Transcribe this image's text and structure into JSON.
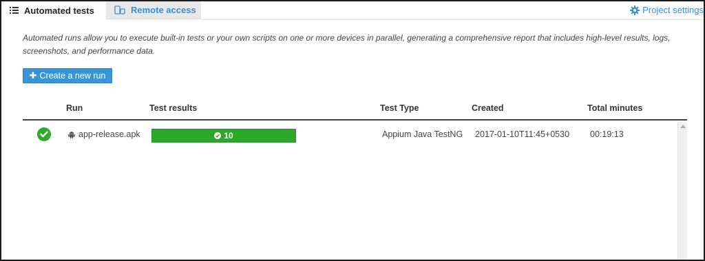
{
  "tabs": [
    {
      "label": "Automated tests",
      "icon": "list-icon",
      "active": true
    },
    {
      "label": "Remote access",
      "icon": "devices-icon",
      "active": false
    }
  ],
  "project_settings": {
    "label": "Project settings",
    "icon": "gear-icon"
  },
  "description": "Automated runs allow you to execute built-in tests or your own scripts on one or more devices in parallel, generating a comprehensive report that includes high-level results, logs, screenshots, and performance data.",
  "create_button": {
    "label": "Create a new run",
    "icon": "plus-icon"
  },
  "table": {
    "columns": [
      "Run",
      "Test results",
      "Test Type",
      "Created",
      "Total minutes"
    ],
    "rows": [
      {
        "status": "passed",
        "status_icon": "check-circle-icon",
        "run": "app-release.apk",
        "platform_icon": "android-icon",
        "passed_count": "10",
        "passed_fraction": 1.0,
        "test_type": "Appium Java TestNG",
        "created": "2017-01-10T11:45+0530",
        "total_minutes": "00:19:13"
      }
    ]
  },
  "colors": {
    "accent": "#3a95d6",
    "link": "#3a8fd0",
    "success": "#2ea82a",
    "tab_inactive_bg": "#e8e8e8"
  }
}
